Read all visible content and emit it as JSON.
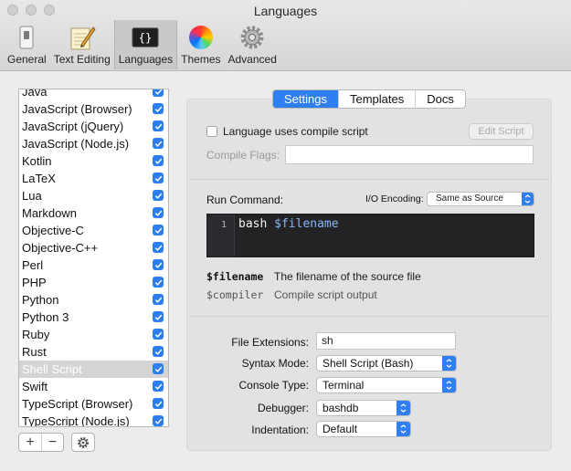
{
  "window": {
    "title": "Languages"
  },
  "toolbar": {
    "items": [
      {
        "label": "General",
        "icon": "switch-icon"
      },
      {
        "label": "Text Editing",
        "icon": "notepad-pencil-icon"
      },
      {
        "label": "Languages",
        "icon": "code-braces-icon",
        "code": "{}"
      },
      {
        "label": "Themes",
        "icon": "color-wheel-icon"
      },
      {
        "label": "Advanced",
        "icon": "gear-icon"
      }
    ],
    "active": "Languages"
  },
  "languages": {
    "items": [
      {
        "name": "Java",
        "checked": true
      },
      {
        "name": "JavaScript (Browser)",
        "checked": true
      },
      {
        "name": "JavaScript (jQuery)",
        "checked": true
      },
      {
        "name": "JavaScript (Node.js)",
        "checked": true
      },
      {
        "name": "Kotlin",
        "checked": true
      },
      {
        "name": "LaTeX",
        "checked": true
      },
      {
        "name": "Lua",
        "checked": true
      },
      {
        "name": "Markdown",
        "checked": true
      },
      {
        "name": "Objective-C",
        "checked": true
      },
      {
        "name": "Objective-C++",
        "checked": true
      },
      {
        "name": "Perl",
        "checked": true
      },
      {
        "name": "PHP",
        "checked": true
      },
      {
        "name": "Python",
        "checked": true
      },
      {
        "name": "Python 3",
        "checked": true
      },
      {
        "name": "Ruby",
        "checked": true
      },
      {
        "name": "Rust",
        "checked": true
      },
      {
        "name": "Shell Script",
        "checked": true,
        "selected": true
      },
      {
        "name": "Swift",
        "checked": true
      },
      {
        "name": "TypeScript (Browser)",
        "checked": true
      },
      {
        "name": "TypeScript (Node.js)",
        "checked": true
      }
    ],
    "add_label": "+",
    "remove_label": "−"
  },
  "tabs": {
    "settings": "Settings",
    "templates": "Templates",
    "docs": "Docs",
    "active": "Settings"
  },
  "compile": {
    "checkbox_label": "Language uses compile script",
    "checked": false,
    "edit_script_label": "Edit Script",
    "flags_label": "Compile Flags:",
    "flags_value": ""
  },
  "run": {
    "label": "Run Command:",
    "io_label": "I/O Encoding:",
    "io_value": "Same as Source",
    "line_number": "1",
    "code_cmd": "bash",
    "code_var": "$filename"
  },
  "variables": [
    {
      "name": "$filename",
      "desc": "The filename of the source file"
    },
    {
      "name": "$compiler",
      "desc": "Compile script output"
    }
  ],
  "settings": {
    "file_extensions_label": "File Extensions:",
    "file_extensions_value": "sh",
    "syntax_mode_label": "Syntax Mode:",
    "syntax_mode_value": "Shell Script (Bash)",
    "console_type_label": "Console Type:",
    "console_type_value": "Terminal",
    "debugger_label": "Debugger:",
    "debugger_value": "bashdb",
    "indentation_label": "Indentation:",
    "indentation_value": "Default"
  },
  "colors": {
    "accent": "#2f7ff3",
    "editor_bg": "#232326"
  }
}
